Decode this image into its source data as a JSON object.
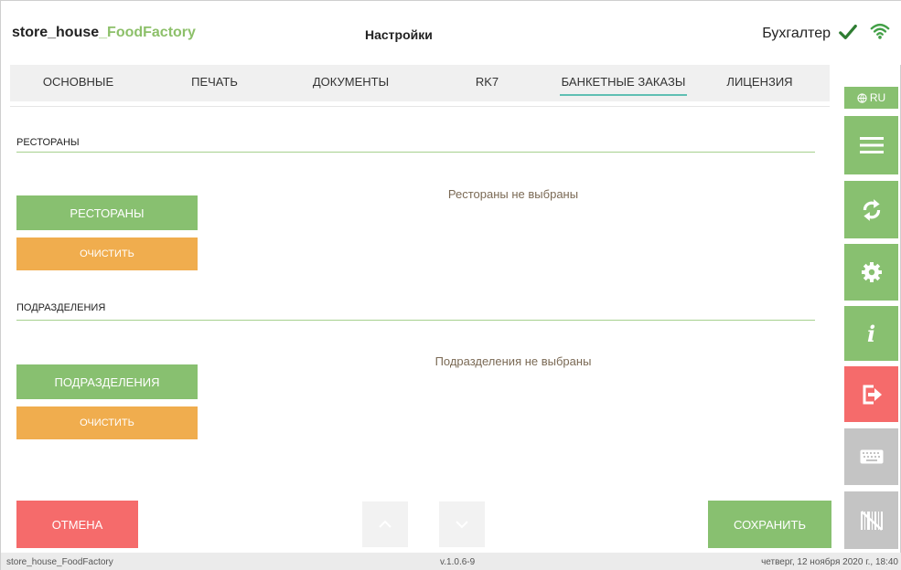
{
  "header": {
    "brand_prefix": "store_house",
    "brand_accent": "_FoodFactory",
    "title": "Настройки",
    "user": "Бухгалтер"
  },
  "tabs": [
    {
      "label": "ОСНОВНЫЕ",
      "active": false
    },
    {
      "label": "ПЕЧАТЬ",
      "active": false
    },
    {
      "label": "ДОКУМЕНТЫ",
      "active": false
    },
    {
      "label": "RK7",
      "active": false
    },
    {
      "label": "БАНКЕТНЫЕ ЗАКАЗЫ",
      "active": true
    },
    {
      "label": "ЛИЦЕНЗИЯ",
      "active": false
    }
  ],
  "restaurants": {
    "section_label": "РЕСТОРАНЫ",
    "empty_message": "Рестораны не выбраны",
    "select_button": "РЕСТОРАНЫ",
    "clear_button": "ОЧИСТИТЬ"
  },
  "departments": {
    "section_label": "ПОДРАЗДЕЛЕНИЯ",
    "empty_message": "Подразделения не выбраны",
    "select_button": "ПОДРАЗДЕЛЕНИЯ",
    "clear_button": "ОЧИСТИТЬ"
  },
  "sidebar": {
    "language": "RU",
    "icons": [
      "menu-icon",
      "sync-icon",
      "gear-icon",
      "info-icon",
      "logout-icon",
      "keyboard-icon",
      "barcode-off-icon"
    ]
  },
  "actions": {
    "cancel_label": "ОТМЕНА",
    "save_label": "СОХРАНИТЬ"
  },
  "footer": {
    "app_name": "store_house_FoodFactory",
    "version": "v.1.0.6-9",
    "datetime": "четверг, 12 ноября 2020 г., 18:40"
  },
  "colors": {
    "green": "#88c070",
    "orange": "#f0ad4e",
    "red": "#f56b6b",
    "gray": "#c4c4c4",
    "tab_underline": "#5fbfb3"
  }
}
